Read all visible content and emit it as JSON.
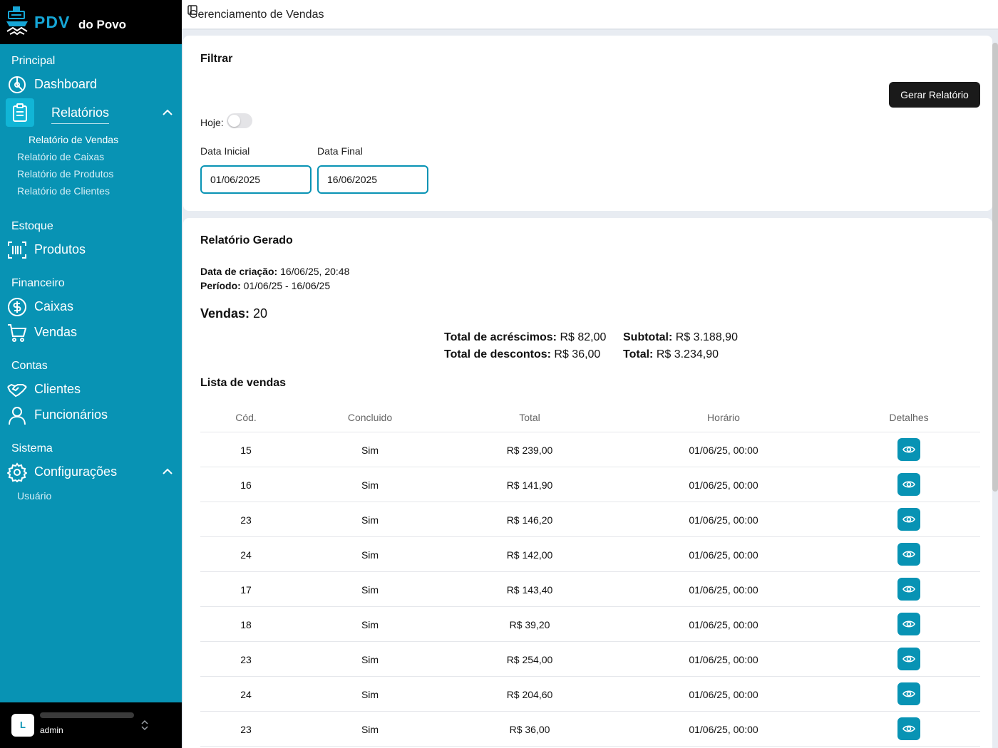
{
  "brand": {
    "name_main": "PDV",
    "name_sub": "do Povo"
  },
  "sidebar": {
    "sections": {
      "principal": "Principal",
      "estoque": "Estoque",
      "financeiro": "Financeiro",
      "contas": "Contas",
      "sistema": "Sistema"
    },
    "items": {
      "dashboard": "Dashboard",
      "relatorios": "Relatórios",
      "produtos": "Produtos",
      "caixas": "Caixas",
      "vendas": "Vendas",
      "clientes": "Clientes",
      "funcionarios": "Funcionários",
      "configuracoes": "Configurações"
    },
    "relatorios_sub": [
      "Relatório de Vendas",
      "Relatório de Caixas",
      "Relatório de Produtos",
      "Relatório de Clientes"
    ],
    "config_sub": [
      "Usuário"
    ]
  },
  "user": {
    "initial": "L",
    "role": "admin"
  },
  "header": {
    "title": "Gerenciamento de Vendas"
  },
  "filter": {
    "title": "Filtrar",
    "generate_button": "Gerar Relatório",
    "today_label": "Hoje:",
    "today_on": false,
    "start_label": "Data Inicial",
    "start_value": "01/06/2025",
    "end_label": "Data Final",
    "end_value": "16/06/2025"
  },
  "report": {
    "title": "Relatório Gerado",
    "created_label": "Data de criação:",
    "created_value": "16/06/25, 20:48",
    "period_label": "Período:",
    "period_value": "01/06/25 - 16/06/25",
    "sales_label": "Vendas:",
    "sales_value": "20",
    "acrescimos_label": "Total de acréscimos:",
    "acrescimos_value": "R$ 82,00",
    "descontos_label": "Total de descontos:",
    "descontos_value": "R$ 36,00",
    "subtotal_label": "Subtotal:",
    "subtotal_value": "R$ 3.188,90",
    "total_label": "Total:",
    "total_value": "R$ 3.234,90",
    "list_title": "Lista de vendas",
    "columns": [
      "Cód.",
      "Concluido",
      "Total",
      "Horário",
      "Detalhes"
    ],
    "rows": [
      {
        "cod": "15",
        "concluido": "Sim",
        "total": "R$ 239,00",
        "horario": "01/06/25, 00:00"
      },
      {
        "cod": "16",
        "concluido": "Sim",
        "total": "R$ 141,90",
        "horario": "01/06/25, 00:00"
      },
      {
        "cod": "23",
        "concluido": "Sim",
        "total": "R$ 146,20",
        "horario": "01/06/25, 00:00"
      },
      {
        "cod": "24",
        "concluido": "Sim",
        "total": "R$ 142,00",
        "horario": "01/06/25, 00:00"
      },
      {
        "cod": "17",
        "concluido": "Sim",
        "total": "R$ 143,40",
        "horario": "01/06/25, 00:00"
      },
      {
        "cod": "18",
        "concluido": "Sim",
        "total": "R$ 39,20",
        "horario": "01/06/25, 00:00"
      },
      {
        "cod": "23",
        "concluido": "Sim",
        "total": "R$ 254,00",
        "horario": "01/06/25, 00:00"
      },
      {
        "cod": "24",
        "concluido": "Sim",
        "total": "R$ 204,60",
        "horario": "01/06/25, 00:00"
      },
      {
        "cod": "23",
        "concluido": "Sim",
        "total": "R$ 36,00",
        "horario": "01/06/25, 00:00"
      }
    ]
  },
  "colors": {
    "accent": "#0893b4",
    "accent_light": "#11b5d6",
    "brand_dark": "#000000",
    "button_dark": "#1a1a1a"
  },
  "icons": [
    "ship-handshake-logo-icon",
    "dashboard-icon",
    "clipboard-icon",
    "chevron-up-icon",
    "barcode-icon",
    "dollar-circle-icon",
    "cart-icon",
    "handshake-icon",
    "user-icon",
    "gear-icon",
    "sidebar-toggle-icon",
    "eye-icon",
    "updown-icon"
  ]
}
